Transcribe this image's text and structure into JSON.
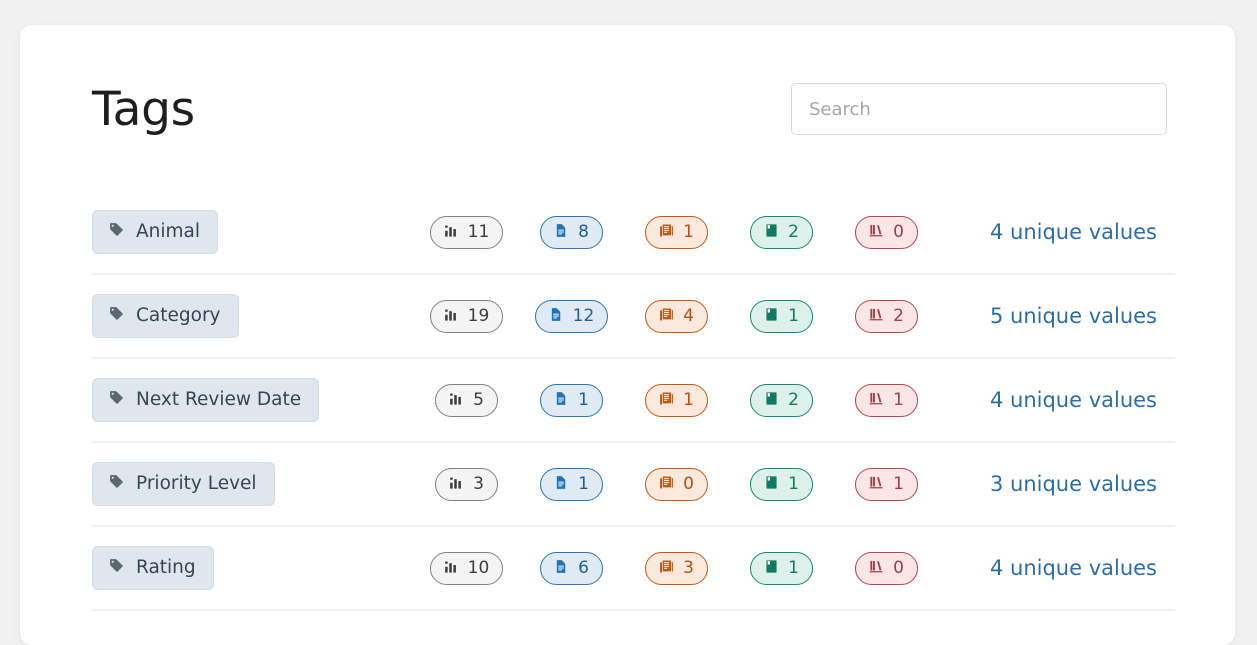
{
  "header": {
    "title": "Tags",
    "search": {
      "placeholder": "Search",
      "value": ""
    }
  },
  "colors": {
    "page_background": "#f1f1f1",
    "card_background": "#ffffff",
    "tag_chip_background": "#dfe6ed",
    "grey_pill": "#818181",
    "blue_pill": "#2b75b8",
    "orange_pill": "#c55a12",
    "green_pill": "#138a72",
    "red_pill": "#b5454f",
    "link": "#2a6eab"
  },
  "count_columns": [
    {
      "key": "stats",
      "icon": "bar-chart-icon",
      "color": "grey"
    },
    {
      "key": "files",
      "icon": "file-text-icon",
      "color": "blue"
    },
    {
      "key": "journals",
      "icon": "journals-icon",
      "color": "orange"
    },
    {
      "key": "book",
      "icon": "book-icon",
      "color": "green"
    },
    {
      "key": "library",
      "icon": "bookshelf-icon",
      "color": "red"
    }
  ],
  "rows": [
    {
      "tag": "Animal",
      "tag_icon": "tag-icon",
      "counts": {
        "stats": "11",
        "files": "8",
        "journals": "1",
        "book": "2",
        "library": "0"
      },
      "unique_values": "4 unique values"
    },
    {
      "tag": "Category",
      "tag_icon": "tag-icon",
      "counts": {
        "stats": "19",
        "files": "12",
        "journals": "4",
        "book": "1",
        "library": "2"
      },
      "unique_values": "5 unique values"
    },
    {
      "tag": "Next Review Date",
      "tag_icon": "tag-icon",
      "counts": {
        "stats": "5",
        "files": "1",
        "journals": "1",
        "book": "2",
        "library": "1"
      },
      "unique_values": "4 unique values"
    },
    {
      "tag": "Priority Level",
      "tag_icon": "tag-icon",
      "counts": {
        "stats": "3",
        "files": "1",
        "journals": "0",
        "book": "1",
        "library": "1"
      },
      "unique_values": "3 unique values"
    },
    {
      "tag": "Rating",
      "tag_icon": "tag-icon",
      "counts": {
        "stats": "10",
        "files": "6",
        "journals": "3",
        "book": "1",
        "library": "0"
      },
      "unique_values": "4 unique values"
    }
  ]
}
